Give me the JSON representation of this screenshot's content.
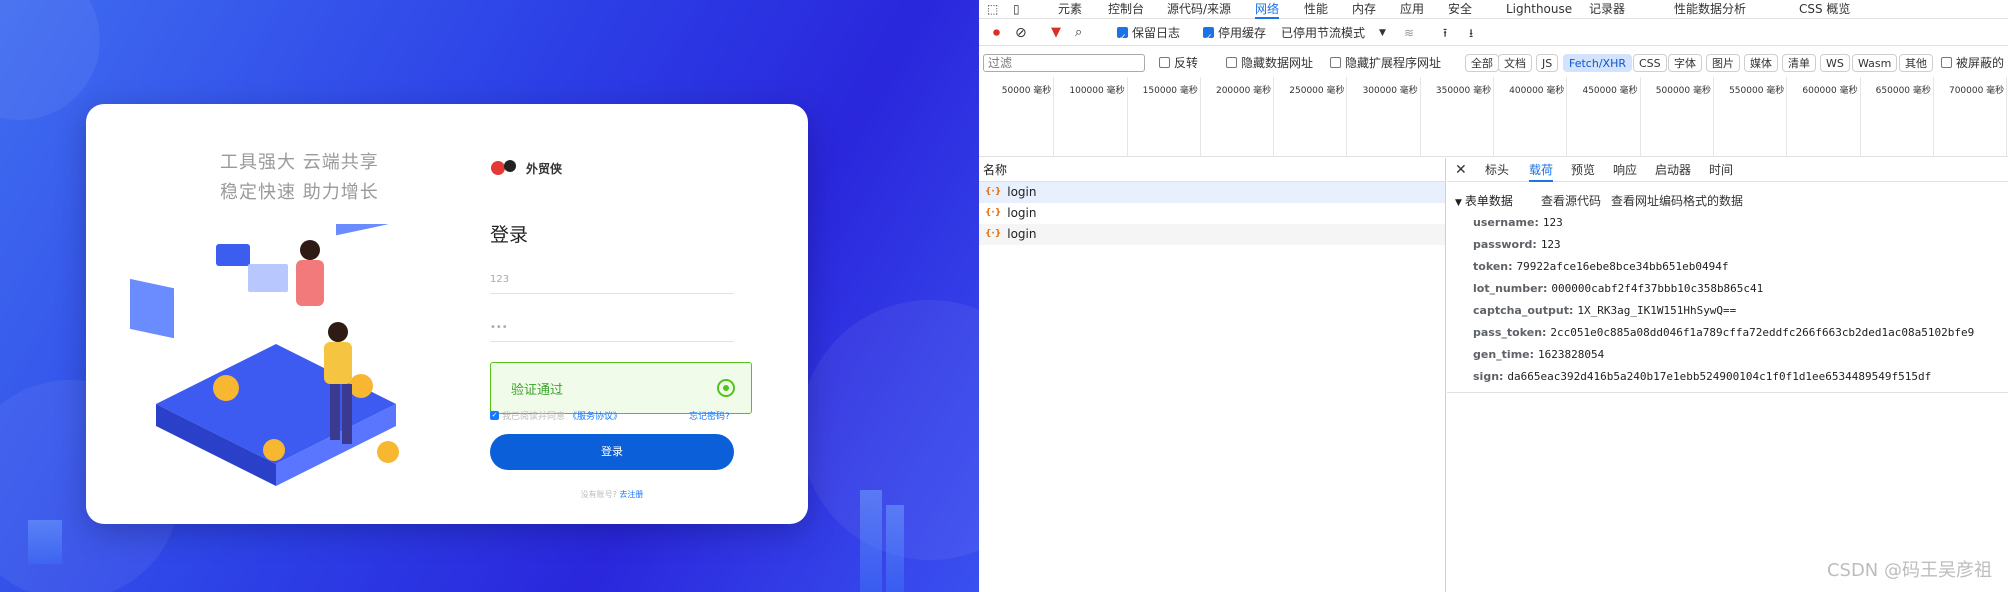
{
  "login_page": {
    "slogan_line1": "工具强大 云端共享",
    "slogan_line2": "稳定快速 助力增长",
    "brand_name": "外贸侠",
    "login_title": "登录",
    "username_value": "123",
    "password_mask": "•••",
    "captcha_text": "验证通过",
    "agree_text": "我已阅读并同意",
    "agree_link": "《服务协议》",
    "forgot_link": "忘记密码?",
    "login_button": "登录",
    "register_prefix": "没有账号?",
    "register_link": "去注册",
    "colors": {
      "primary": "#0b5fd8",
      "success": "#52c41a",
      "bg": "#2c3fe6"
    }
  },
  "devtools": {
    "tabs": [
      "元素",
      "控制台",
      "源代码/来源",
      "网络",
      "性能",
      "内存",
      "应用",
      "安全",
      "Lighthouse",
      "记录器",
      "性能数据分析",
      "CSS 概览"
    ],
    "active_tab": "网络",
    "toolbar": {
      "preserve_log": "保留日志",
      "disable_cache": "停用缓存",
      "throttle": "已停用节流模式"
    },
    "filter": {
      "placeholder": "过滤",
      "invert": "反转",
      "hide_data_urls": "隐藏数据网址",
      "hide_ext_urls": "隐藏扩展程序网址",
      "chips": [
        "全部",
        "文档",
        "JS",
        "Fetch/XHR",
        "CSS",
        "字体",
        "图片",
        "媒体",
        "清单",
        "WS",
        "Wasm",
        "其他"
      ],
      "active_chip": "Fetch/XHR",
      "blocked": "被屏蔽的"
    },
    "timeline_ticks": [
      "50000 毫秒",
      "100000 毫秒",
      "150000 毫秒",
      "200000 毫秒",
      "250000 毫秒",
      "300000 毫秒",
      "350000 毫秒",
      "400000 毫秒",
      "450000 毫秒",
      "500000 毫秒",
      "550000 毫秒",
      "600000 毫秒",
      "650000 毫秒",
      "700000 毫秒"
    ],
    "names_header": "名称",
    "requests": [
      "login",
      "login",
      "login"
    ],
    "detail_tabs": [
      "标头",
      "载荷",
      "预览",
      "响应",
      "启动器",
      "时间"
    ],
    "active_detail_tab": "载荷",
    "payload": {
      "section": "表单数据",
      "view_source": "查看源代码",
      "view_url_encoded": "查看网址编码格式的数据",
      "rows": [
        {
          "key": "username:",
          "value": "123"
        },
        {
          "key": "password:",
          "value": "123"
        },
        {
          "key": "token:",
          "value": "79922afce16ebe8bce34bb651eb0494f"
        },
        {
          "key": "lot_number:",
          "value": "000000cabf2f4f37bbb10c358b865c41"
        },
        {
          "key": "captcha_output:",
          "value": "1X_RK3ag_IK1W151HhSywQ=="
        },
        {
          "key": "pass_token:",
          "value": "2cc051e0c885a08dd046f1a789cffa72eddfc266f663cb2ded1ac08a5102bfe9"
        },
        {
          "key": "gen_time:",
          "value": "1623828054"
        },
        {
          "key": "sign:",
          "value": "da665eac392d416b5a240b17e1ebb524900104c1f0f1d1ee6534489549f515df"
        }
      ]
    },
    "watermark": "CSDN @码王吴彦祖"
  }
}
